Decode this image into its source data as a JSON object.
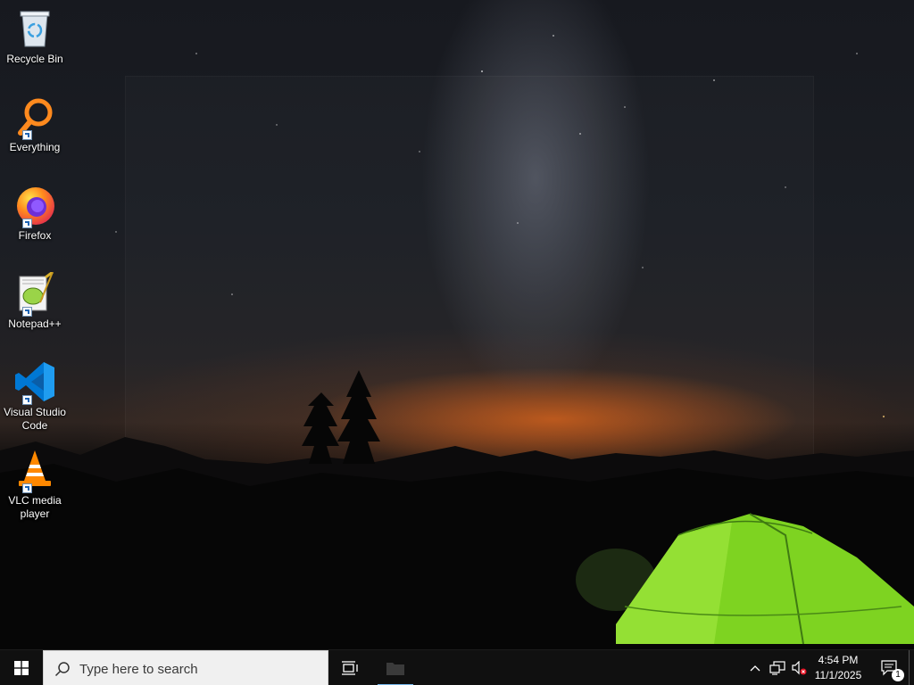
{
  "desktop": {
    "icons": [
      {
        "label": "Recycle Bin",
        "icon": "recycle-bin-icon"
      },
      {
        "label": "Everything",
        "icon": "everything-search-icon"
      },
      {
        "label": "Firefox",
        "icon": "firefox-icon"
      },
      {
        "label": "Notepad++",
        "icon": "notepad-plus-plus-icon"
      },
      {
        "label": "Visual Studio Code",
        "icon": "vscode-icon"
      },
      {
        "label": "VLC media player",
        "icon": "vlc-icon"
      }
    ]
  },
  "taskbar": {
    "start_icon": "windows-logo-icon",
    "search_placeholder": "Type here to search",
    "task_view_icon": "task-view-icon",
    "pinned_app_icon": "file-explorer-icon",
    "tray": {
      "overflow_icon": "chevron-up-icon",
      "network_icon": "network-icon",
      "volume_icon": "volume-muted-icon"
    },
    "clock": {
      "time": "4:54 PM",
      "date": "11/1/2025"
    },
    "notification_count": "1"
  },
  "colors": {
    "taskbar": "#101010",
    "search_box": "#f0f0f0",
    "active_indicator": "#76b9ed",
    "tent": "#7ed321",
    "horizon_glow": "#d66018"
  }
}
